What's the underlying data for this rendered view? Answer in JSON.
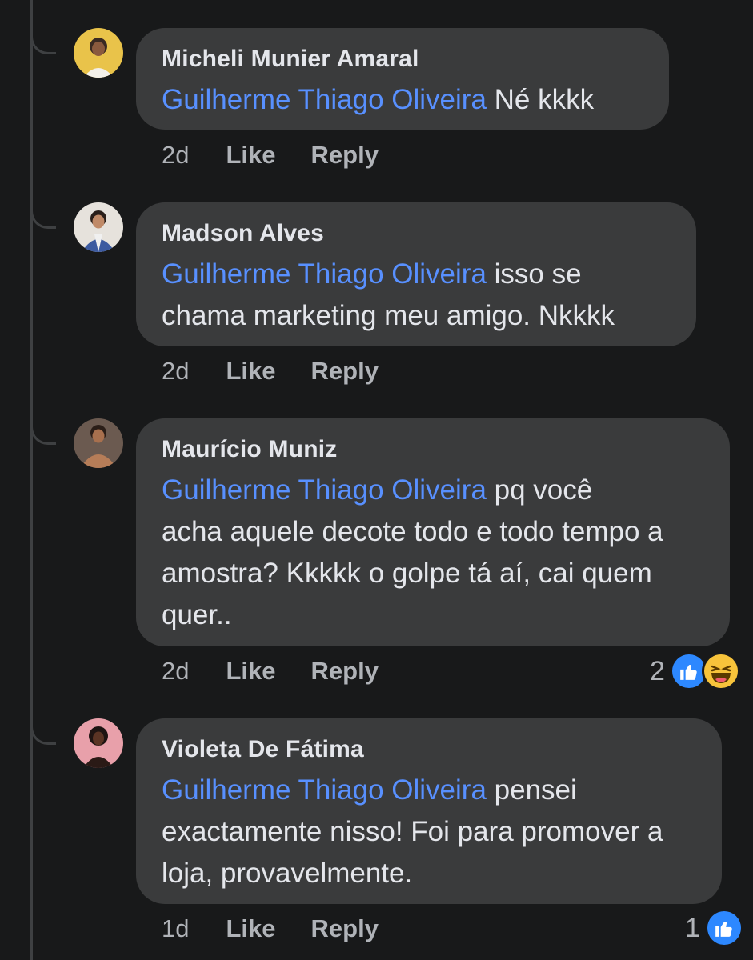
{
  "comments": [
    {
      "author": "Micheli Munier Amaral",
      "mention": "Guilherme Thiago Oliveira",
      "text_line1": " Né kkkk",
      "text_rest": "",
      "time": "2d",
      "like_label": "Like",
      "reply_label": "Reply",
      "avatar": "avatar-yellow-bg"
    },
    {
      "author": "Madson Alves",
      "mention": "Guilherme Thiago Oliveira",
      "text_line1": " isso se",
      "text_rest": "chama marketing meu amigo. Nkkkk",
      "time": "2d",
      "like_label": "Like",
      "reply_label": "Reply",
      "avatar": "avatar-suit"
    },
    {
      "author": "Maurício Muniz",
      "mention": "Guilherme Thiago Oliveira",
      "text_line1": " pq você",
      "text_rest": "acha aquele decote todo e todo tempo a amostra? Kkkkk o golpe tá aí, cai quem quer..",
      "time": "2d",
      "like_label": "Like",
      "reply_label": "Reply",
      "reaction_count": "2",
      "reactions": [
        "like-icon",
        "haha-icon"
      ],
      "avatar": "avatar-shirtless"
    },
    {
      "author": "Violeta De Fátima",
      "mention": "Guilherme Thiago Oliveira",
      "text_line1": " pensei",
      "text_rest": "exactamente nisso! Foi para promover a loja, provavelmente.",
      "time": "1d",
      "like_label": "Like",
      "reply_label": "Reply",
      "reaction_count": "1",
      "reactions": [
        "like-icon"
      ],
      "avatar": "avatar-pink-bg"
    }
  ],
  "colors": {
    "background": "#18191a",
    "bubble": "#3a3b3c",
    "mention": "#5890ff",
    "text": "#e4e6eb",
    "muted": "#b0b3b8"
  }
}
